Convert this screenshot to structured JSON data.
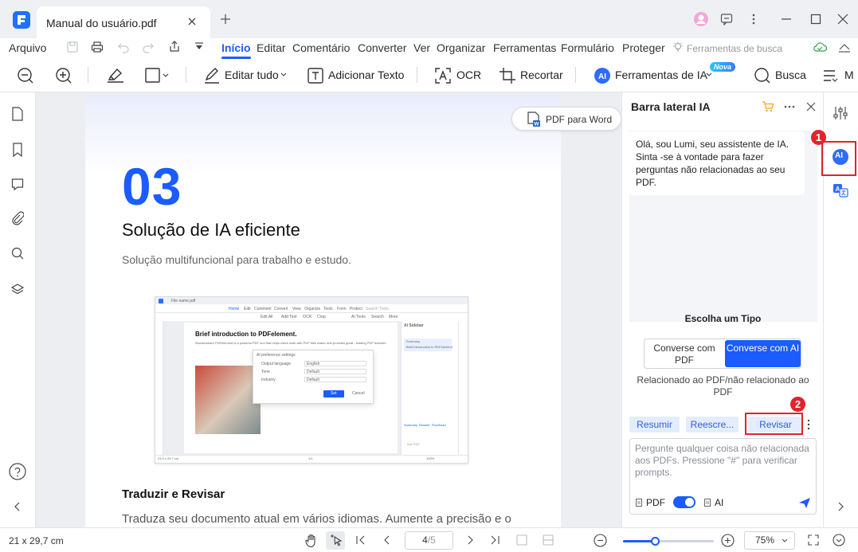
{
  "window": {
    "tab_title": "Manual do usuário.pdf"
  },
  "menu": {
    "file": "Arquivo",
    "items": [
      "Início",
      "Editar",
      "Comentário",
      "Converter",
      "Ver",
      "Organizar",
      "Ferramentas",
      "Formulário",
      "Proteger"
    ],
    "active_index": 0,
    "search_tools": "Ferramentas de busca"
  },
  "toolbar": {
    "edit_all": "Editar tudo",
    "add_text": "Adicionar Texto",
    "ocr": "OCR",
    "crop": "Recortar",
    "ai_tools": "Ferramentas de IA",
    "new_badge": "Nova",
    "search": "Busca",
    "more": "M"
  },
  "document": {
    "number": "03",
    "heading": "Solução de IA eficiente",
    "subheading": "Solução multifuncional para trabalho e estudo.",
    "section_title": "Traduzir e Revisar",
    "section_text": "Traduza seu documento atual em vários idiomas. Aumente a precisão e o",
    "pdf_to_word": "PDF para Word",
    "screenshot": {
      "tab": "File name.pdf",
      "menu": [
        "Home",
        "Edit",
        "Comment",
        "Convert",
        "View",
        "Organize",
        "Tools",
        "Form",
        "Protect"
      ],
      "search_tools": "Search Tools",
      "tools": [
        "Edit All",
        "Add Text",
        "OCR",
        "Crop",
        "AI Tools",
        "Search",
        "More"
      ],
      "title": "Brief introduction to PDFelement.",
      "body": "Wondershare PDFelement is a powerful PDF tool that helps users work with PDF files easier and provides great - leading PDF features",
      "dialog": {
        "title": "AI preference settings",
        "fields": [
          {
            "label": "Output language",
            "value": "English"
          },
          {
            "label": "Tone",
            "value": "Default"
          },
          {
            "label": "Industry",
            "value": "Default"
          }
        ],
        "set": "Set",
        "cancel": "Cancel"
      },
      "sidebar": {
        "title": "AI Sidebar",
        "summary": "Summary",
        "summary_text": "Brief introduction to PDFelement",
        "prompt": "Ask PDF",
        "tabs": [
          "Summary",
          "Rewrite",
          "Proofread"
        ]
      },
      "footer": "21.0 x 29.7 cm",
      "page": "1/1",
      "zoom": "100%"
    }
  },
  "ai_panel": {
    "title": "Barra lateral IA",
    "greeting": "Olá, sou Lumi, seu assistente de IA. Sinta -se à vontade para fazer perguntas não relacionadas ao seu PDF.",
    "choose_type": "Escolha um Tipo",
    "type_pdf": "Converse com PDF",
    "type_ai": "Converse com AI",
    "type_desc": "Relacionado ao PDF/não relacionado ao PDF",
    "chips": [
      "Resumir",
      "Reescre...",
      "Revisar"
    ],
    "placeholder": "Pergunte qualquer coisa não relacionada aos PDFs. Pressione \"#\" para verificar prompts.",
    "pdf_label": "PDF",
    "ai_label": "AI"
  },
  "right_bar": {
    "ai_icon": "AI"
  },
  "annotations": {
    "badge1": "1",
    "badge2": "2"
  },
  "status": {
    "page_size": "21 x 29,7 cm",
    "current_page": "4",
    "total_pages": "/5",
    "zoom": "75%",
    "zoom_level": 0.35
  }
}
